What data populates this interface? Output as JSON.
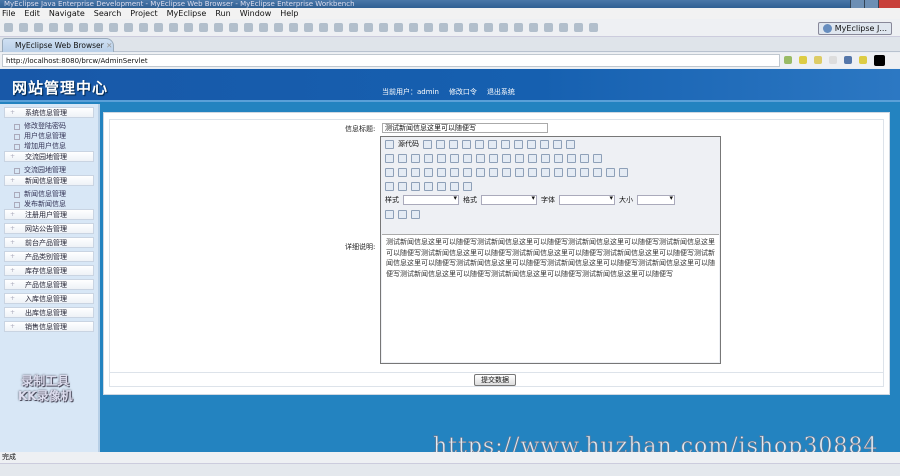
{
  "window": {
    "title": "MyEclipse Java Enterprise Development - MyEclipse Web Browser - MyEclipse Enterprise Workbench"
  },
  "menu": [
    "File",
    "Edit",
    "Navigate",
    "Search",
    "Project",
    "MyEclipse",
    "Run",
    "Window",
    "Help"
  ],
  "perspective": "MyEclipse J...",
  "tab": {
    "label": "MyEclipse Web Browser"
  },
  "browser": {
    "url": "http://localhost:8080/brcw/AdminServlet"
  },
  "header": {
    "logo": "网站管理中心",
    "user_label": "当前用户：admin",
    "change_pwd": "修改口令",
    "logout": "退出系统"
  },
  "sidebar": [
    {
      "label": "系统信息管理",
      "items": [
        "修改登陆密码",
        "用户信息管理",
        "增加用户信息"
      ]
    },
    {
      "label": "交流园地管理",
      "items": [
        "交流园地管理"
      ]
    },
    {
      "label": "新闻信息管理",
      "items": [
        "新闻信息管理",
        "发布新闻信息"
      ]
    },
    {
      "label": "注册用户管理",
      "items": []
    },
    {
      "label": "网站公告管理",
      "items": []
    },
    {
      "label": "前台产品管理",
      "items": []
    },
    {
      "label": "产品类别管理",
      "items": []
    },
    {
      "label": "库存信息管理",
      "items": []
    },
    {
      "label": "产品信息管理",
      "items": []
    },
    {
      "label": "入库信息管理",
      "items": []
    },
    {
      "label": "出库信息管理",
      "items": []
    },
    {
      "label": "销售信息管理",
      "items": []
    }
  ],
  "form": {
    "title_label": "信息标题:",
    "title_value": "测试新闻信息这里可以随便写",
    "detail_label": "详细说明:",
    "editor": {
      "source_button": "源代码",
      "style_label": "样式",
      "format_label": "格式",
      "font_label": "字体",
      "size_label": "大小"
    },
    "content": "测试新闻信息这里可以随便写测试新闻信息这里可以随便写测试新闻信息这里可以随便写测试新闻信息这里可以随便写测试新闻信息这里可以随便写测试新闻信息这里可以随便写测试新闻信息这里可以随便写测试新闻信息这里可以随便写测试新闻信息这里可以随便写测试新闻信息这里可以随便写测试新闻信息这里可以随便写测试新闻信息这里可以随便写测试新闻信息这里可以随便写测试新闻信息这里可以随便写",
    "submit": "提交数据"
  },
  "overlay": {
    "recorder": "录制工具",
    "recorder2": "KK录像机",
    "watermark": "https://www.huzhan.com/ishop30884"
  },
  "status": "完成"
}
